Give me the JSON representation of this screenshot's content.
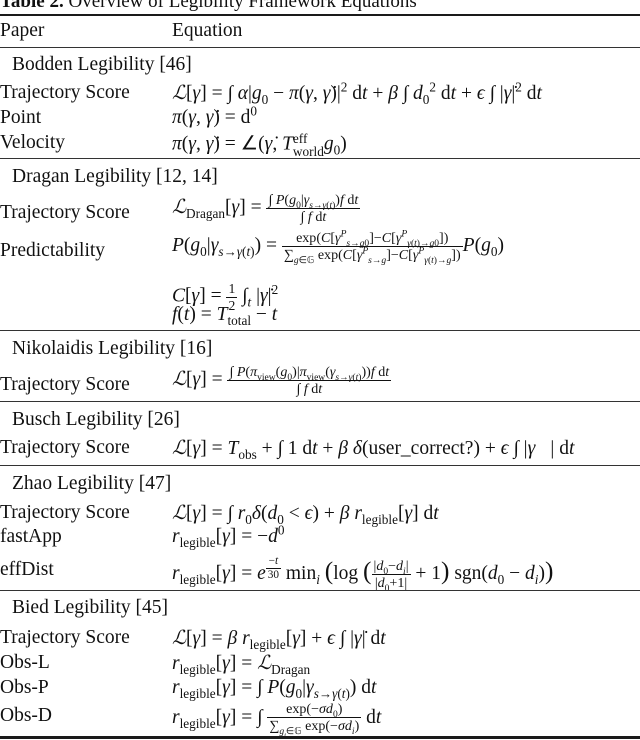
{
  "caption": {
    "label": "Table 2.",
    "text": "Overview of Legibility Framework Equations"
  },
  "header": {
    "col1": "Paper",
    "col2": "Equation"
  },
  "sections": [
    {
      "title": "Bodden Legibility [46]",
      "rows": [
        {
          "name": "Trajectory Score",
          "equation": "𝓛[γ] = ∫ α|g₀ − π(γ, γ̇)|² dt + β ∫ d₀² dt + ϵ ∫ |γ̇|² dt"
        },
        {
          "name": "Point",
          "equation": "π(γ, γ̇) = d⁰"
        },
        {
          "name": "Velocity",
          "equation": "π(γ, γ̇) = ∠(γ̇, T_world^eff g₀)"
        }
      ]
    },
    {
      "title": "Dragan Legibility [12, 14]",
      "rows": [
        {
          "name": "Trajectory Score",
          "equation": "𝓛_Dragan[γ] = ∫ P(g₀|γ_{s→γ(t)}) f dt / ∫ f dt"
        },
        {
          "name": "Predictability",
          "equation": "P(g₀|γ_{s→γ(t)}) = exp(C[γ^P_{s→g₀}] − C[γ^P_{γ(t)→g₀}]) / Σ_{g∈G} exp(C[γ^P_{s→g}] − C[γ^P_{γ(t)→g}]) P(g₀)"
        },
        {
          "name": "",
          "equation": "C[γ] = ½ ∫_t |γ̇|²"
        },
        {
          "name": "",
          "equation": "f(t) = T_total − t"
        }
      ]
    },
    {
      "title": "Nikolaidis Legibility [16]",
      "rows": [
        {
          "name": "Trajectory Score",
          "equation": "𝓛[γ] = ∫ P(π_view(g₀)|π_view(γ_{s→γ(t)})) f dt / ∫ f dt"
        }
      ]
    },
    {
      "title": "Busch Legibility [26]",
      "rows": [
        {
          "name": "Trajectory Score",
          "equation": "𝓛[γ] = T_obs + ∫ 1 dt + β δ(user_correct?) + ϵ ∫ |γ⃛| dt"
        }
      ]
    },
    {
      "title": "Zhao Legibility [47]",
      "rows": [
        {
          "name": "Trajectory Score",
          "equation": "𝓛[γ] = ∫ r₀δ(d₀ < ϵ) + β r_legible[γ] dt"
        },
        {
          "name": "fastApp",
          "equation": "r_legible[γ] = −d⁰"
        },
        {
          "name": "effDist",
          "equation": "r_legible[γ] = e^(−t/30) min_i (log(|d₀−d_i| / |d₀+1| + 1) sgn(d₀ − d_i))"
        }
      ]
    },
    {
      "title": "Bied Legibility [45]",
      "rows": [
        {
          "name": "Trajectory Score",
          "equation": "𝓛[γ] = β r_legible[γ] + ϵ ∫ |γ̇| dt"
        },
        {
          "name": "Obs-L",
          "equation": "r_legible[γ] = 𝓛_Dragan"
        },
        {
          "name": "Obs-P",
          "equation": "r_legible[γ] = ∫ P(g₀|γ_{s→γ(t)}) dt"
        },
        {
          "name": "Obs-D",
          "equation": "r_legible[γ] = ∫ exp(−σd₀) / Σ_{g_i∈G} exp(−σd_i) dt"
        }
      ]
    }
  ]
}
